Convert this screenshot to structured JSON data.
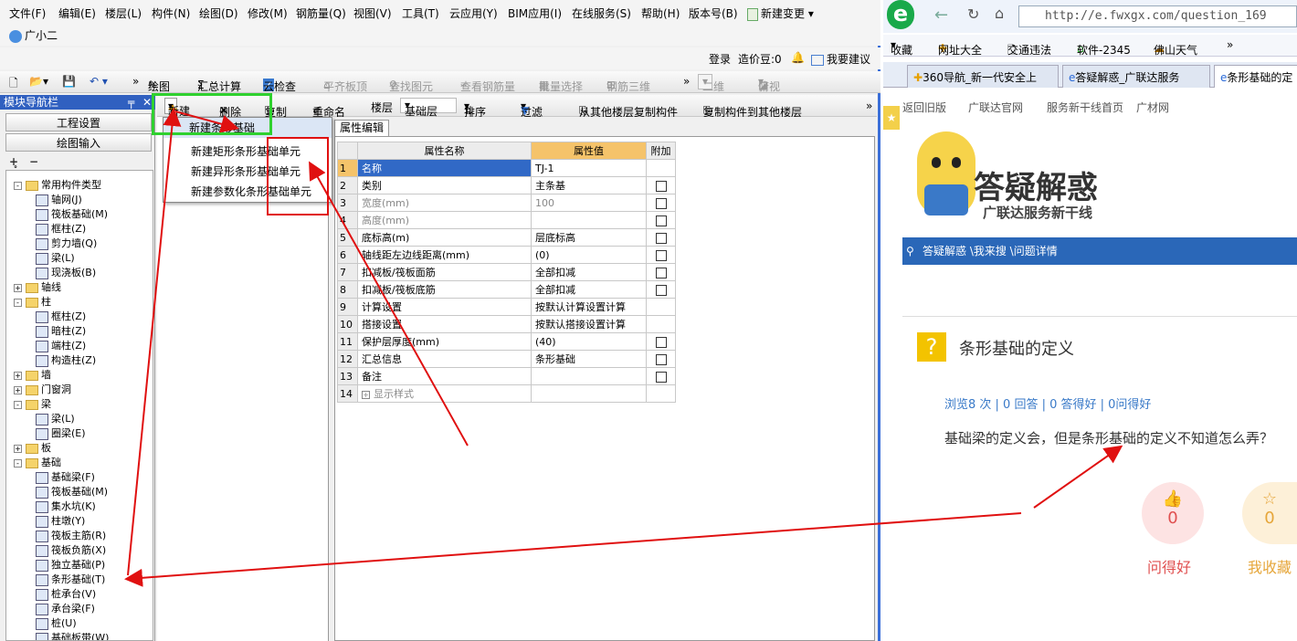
{
  "menu": [
    "文件(F)",
    "编辑(E)",
    "楼层(L)",
    "构件(N)",
    "绘图(D)",
    "修改(M)",
    "钢筋量(Q)",
    "视图(V)",
    "工具(T)",
    "云应用(Y)",
    "BIM应用(I)",
    "在线服务(S)",
    "帮助(H)",
    "版本号(B)",
    "新建变更"
  ],
  "assistant": "广小二",
  "login": {
    "login": "登录",
    "price": "造价豆:0",
    "suggest": "我要建议"
  },
  "toolbar1": {
    "draw": "绘图",
    "calc": "汇总计算",
    "cloud": "云检查",
    "flat": "平齐板顶",
    "find": "查找图元",
    "view_rebar": "查看钢筋量",
    "batch": "批量选择",
    "rebar3d": "钢筋三维",
    "view2d": "二维",
    "view_mode": "俯视"
  },
  "nav": {
    "title": "模块导航栏",
    "btn1": "工程设置",
    "btn2": "绘图输入"
  },
  "tree": [
    {
      "t": "常用构件类型",
      "lvl": 0,
      "exp": "-",
      "folder": true
    },
    {
      "t": "轴网(J)",
      "lvl": 1
    },
    {
      "t": "筏板基础(M)",
      "lvl": 1
    },
    {
      "t": "框柱(Z)",
      "lvl": 1
    },
    {
      "t": "剪力墙(Q)",
      "lvl": 1
    },
    {
      "t": "梁(L)",
      "lvl": 1
    },
    {
      "t": "现浇板(B)",
      "lvl": 1
    },
    {
      "t": "轴线",
      "lvl": 0,
      "exp": "+",
      "folder": true
    },
    {
      "t": "柱",
      "lvl": 0,
      "exp": "-",
      "folder": true
    },
    {
      "t": "框柱(Z)",
      "lvl": 1
    },
    {
      "t": "暗柱(Z)",
      "lvl": 1
    },
    {
      "t": "端柱(Z)",
      "lvl": 1
    },
    {
      "t": "构造柱(Z)",
      "lvl": 1
    },
    {
      "t": "墙",
      "lvl": 0,
      "exp": "+",
      "folder": true
    },
    {
      "t": "门窗洞",
      "lvl": 0,
      "exp": "+",
      "folder": true
    },
    {
      "t": "梁",
      "lvl": 0,
      "exp": "-",
      "folder": true
    },
    {
      "t": "梁(L)",
      "lvl": 1
    },
    {
      "t": "圈梁(E)",
      "lvl": 1
    },
    {
      "t": "板",
      "lvl": 0,
      "exp": "+",
      "folder": true
    },
    {
      "t": "基础",
      "lvl": 0,
      "exp": "-",
      "folder": true
    },
    {
      "t": "基础梁(F)",
      "lvl": 1
    },
    {
      "t": "筏板基础(M)",
      "lvl": 1
    },
    {
      "t": "集水坑(K)",
      "lvl": 1
    },
    {
      "t": "柱墩(Y)",
      "lvl": 1
    },
    {
      "t": "筏板主筋(R)",
      "lvl": 1
    },
    {
      "t": "筏板负筋(X)",
      "lvl": 1
    },
    {
      "t": "独立基础(P)",
      "lvl": 1
    },
    {
      "t": "条形基础(T)",
      "lvl": 1
    },
    {
      "t": "桩承台(V)",
      "lvl": 1
    },
    {
      "t": "承台梁(F)",
      "lvl": 1
    },
    {
      "t": "桩(U)",
      "lvl": 1
    },
    {
      "t": "基础板带(W)",
      "lvl": 1
    }
  ],
  "toolbar2": {
    "new": "新建",
    "delete": "删除",
    "copy": "复制",
    "rename": "重命名",
    "floor_label": "楼层",
    "floor_value": "基础层",
    "sort": "排序",
    "filter": "过滤",
    "copy_from": "从其他楼层复制构件",
    "copy_to": "复制构件到其他楼层"
  },
  "dropdown": {
    "header": "新建条形基础",
    "items": [
      "新建矩形条形基础单元",
      "新建异形条形基础单元",
      "新建参数化条形基础单元"
    ]
  },
  "prop": {
    "tab": "属性编辑",
    "headers": [
      "属性名称",
      "属性值",
      "附加"
    ],
    "rows": [
      {
        "n": "1",
        "name": "名称",
        "value": "TJ-1",
        "cb": false,
        "grey": false
      },
      {
        "n": "2",
        "name": "类别",
        "value": "主条基",
        "cb": true,
        "grey": false
      },
      {
        "n": "3",
        "name": "宽度(mm)",
        "value": "100",
        "cb": true,
        "grey": true
      },
      {
        "n": "4",
        "name": "高度(mm)",
        "value": "",
        "cb": true,
        "grey": true
      },
      {
        "n": "5",
        "name": "底标高(m)",
        "value": "层底标高",
        "cb": true,
        "grey": false
      },
      {
        "n": "6",
        "name": "轴线距左边线距离(mm)",
        "value": "(0)",
        "cb": true,
        "grey": false
      },
      {
        "n": "7",
        "name": "扣减板/筏板面筋",
        "value": "全部扣减",
        "cb": true,
        "grey": false
      },
      {
        "n": "8",
        "name": "扣减板/筏板底筋",
        "value": "全部扣减",
        "cb": true,
        "grey": false
      },
      {
        "n": "9",
        "name": "计算设置",
        "value": "按默认计算设置计算",
        "cb": false,
        "grey": false
      },
      {
        "n": "10",
        "name": "搭接设置",
        "value": "按默认搭接设置计算",
        "cb": false,
        "grey": false
      },
      {
        "n": "11",
        "name": "保护层厚度(mm)",
        "value": "(40)",
        "cb": true,
        "grey": false
      },
      {
        "n": "12",
        "name": "汇总信息",
        "value": "条形基础",
        "cb": true,
        "grey": false
      },
      {
        "n": "13",
        "name": "备注",
        "value": "",
        "cb": true,
        "grey": false
      },
      {
        "n": "14",
        "name": "显示样式",
        "value": "",
        "cb": false,
        "grey": true
      }
    ]
  },
  "browser": {
    "url": "http://e.fwxgx.com/question_169",
    "fav": [
      "收藏",
      "网址大全",
      "交通违法",
      "软件-2345",
      "佛山天气"
    ],
    "tabs": [
      "360导航_新一代安全上",
      "答疑解惑_广联达服务",
      "条形基础的定"
    ],
    "sitenav": [
      "返回旧版",
      "广联达官网",
      "服务新干线首页",
      "广材网"
    ],
    "logo_title": "答疑解惑",
    "logo_sub": "广联达服务新干线",
    "breadcrumb": "答疑解惑 \\我来搜 \\问题详情",
    "q_title": "条形基础的定义",
    "q_stats": "浏览8 次 | 0 回答 | 0 答得好 | 0问得好",
    "q_body": "基础梁的定义会，但是条形基础的定义不知道怎么弄？",
    "like_count": "0",
    "like_label": "问得好",
    "fav_count": "0",
    "fav_label": "我收藏"
  }
}
